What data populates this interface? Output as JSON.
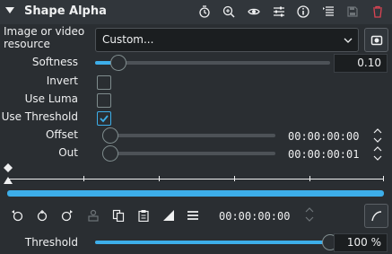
{
  "header": {
    "title": "Shape Alpha"
  },
  "resource": {
    "label": "Image or video resource",
    "value": "Custom..."
  },
  "softness": {
    "label": "Softness",
    "value": "0.10",
    "fraction": 0.1
  },
  "invert": {
    "label": "Invert",
    "checked": false
  },
  "use_luma": {
    "label": "Use Luma",
    "checked": false
  },
  "use_threshold": {
    "label": "Use Threshold",
    "checked": true
  },
  "offset": {
    "label": "Offset",
    "timecode": "00:00:00:00"
  },
  "out": {
    "label": "Out",
    "timecode": "00:00:00:01"
  },
  "keyframe_toolbar": {
    "timecode": "00:00:00:00"
  },
  "threshold": {
    "label": "Threshold",
    "value": "100 %",
    "fraction": 1.0
  },
  "colors": {
    "accent": "#3daee9",
    "background": "#2a2e32",
    "field": "#1b1e20",
    "delete": "#da4453"
  },
  "icons": {
    "header": [
      "timer-icon",
      "zoom-icon",
      "eye-icon",
      "sliders-icon",
      "info-icon",
      "list-icon",
      "save-icon",
      "trash-icon"
    ],
    "toolbar": [
      "previous-keyframe-icon",
      "add-keyframe-icon",
      "next-keyframe-icon",
      "lock-icon",
      "copy-icon",
      "paste-icon",
      "ramp-icon",
      "menu-icon",
      "curve-icon"
    ]
  }
}
